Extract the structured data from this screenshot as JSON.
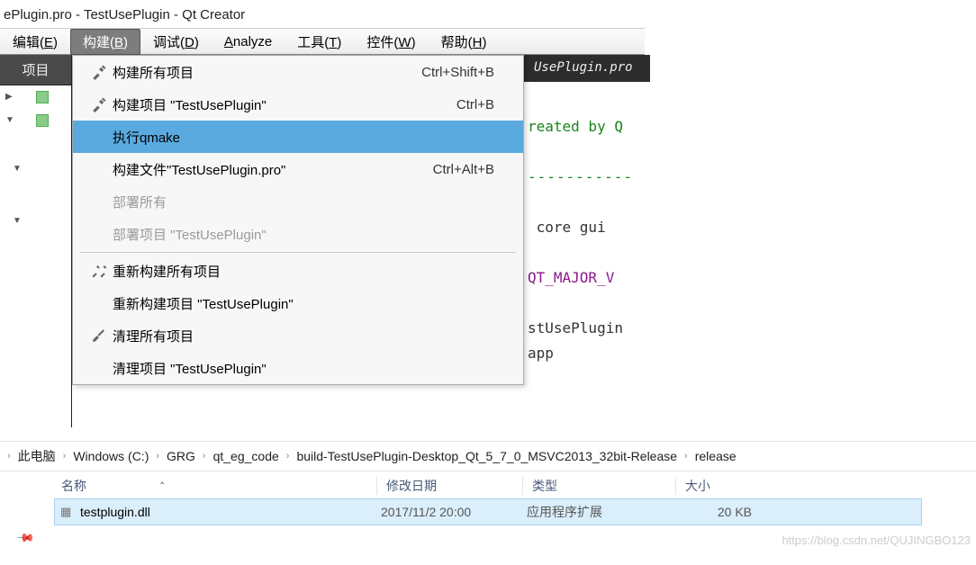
{
  "window": {
    "title": "ePlugin.pro - TestUsePlugin - Qt Creator"
  },
  "menubar": {
    "items": [
      {
        "label": "编辑(E)",
        "key": "E"
      },
      {
        "label": "构建(B)",
        "key": "B",
        "active": true
      },
      {
        "label": "调试(D)",
        "key": "D"
      },
      {
        "label": "Analyze",
        "key": "A"
      },
      {
        "label": "工具(T)",
        "key": "T"
      },
      {
        "label": "控件(W)",
        "key": "W"
      },
      {
        "label": "帮助(H)",
        "key": "H"
      }
    ]
  },
  "sidetab": {
    "label": "项目"
  },
  "build_menu": {
    "items": [
      {
        "icon": "hammer",
        "label": "构建所有项目",
        "shortcut": "Ctrl+Shift+B"
      },
      {
        "icon": "hammer",
        "label": "构建项目 \"TestUsePlugin\"",
        "shortcut": "Ctrl+B"
      },
      {
        "icon": "",
        "label": "执行qmake",
        "shortcut": "",
        "highlighted": true
      },
      {
        "icon": "",
        "label": "构建文件\"TestUsePlugin.pro\"",
        "shortcut": "Ctrl+Alt+B"
      },
      {
        "icon": "",
        "label": "部署所有",
        "disabled": true
      },
      {
        "icon": "",
        "label": "部署项目 \"TestUsePlugin\"",
        "disabled": true
      },
      {
        "sep": true
      },
      {
        "icon": "hammers",
        "label": "重新构建所有项目"
      },
      {
        "icon": "",
        "label": "重新构建项目 \"TestUsePlugin\""
      },
      {
        "icon": "broom",
        "label": "清理所有项目"
      },
      {
        "icon": "",
        "label": "清理项目 \"TestUsePlugin\""
      }
    ]
  },
  "editor": {
    "tab": "UsePlugin.pro",
    "lines": {
      "l1": "reated by Q",
      "l2": "-----------",
      "l3": " core gui",
      "l4": "QT_MAJOR_V",
      "l5": "stUsePlugin",
      "l6": "app"
    }
  },
  "breadcrumb": {
    "segs": [
      "此电脑",
      "Windows (C:)",
      "GRG",
      "qt_eg_code",
      "build-TestUsePlugin-Desktop_Qt_5_7_0_MSVC2013_32bit-Release",
      "release"
    ]
  },
  "file_list": {
    "headers": {
      "name": "名称",
      "date": "修改日期",
      "type": "类型",
      "size": "大小"
    },
    "row": {
      "name": "testplugin.dll",
      "date": "2017/11/2 20:00",
      "type": "应用程序扩展",
      "size": "20 KB"
    }
  },
  "watermark": "https://blog.csdn.net/QUJINGBO123"
}
